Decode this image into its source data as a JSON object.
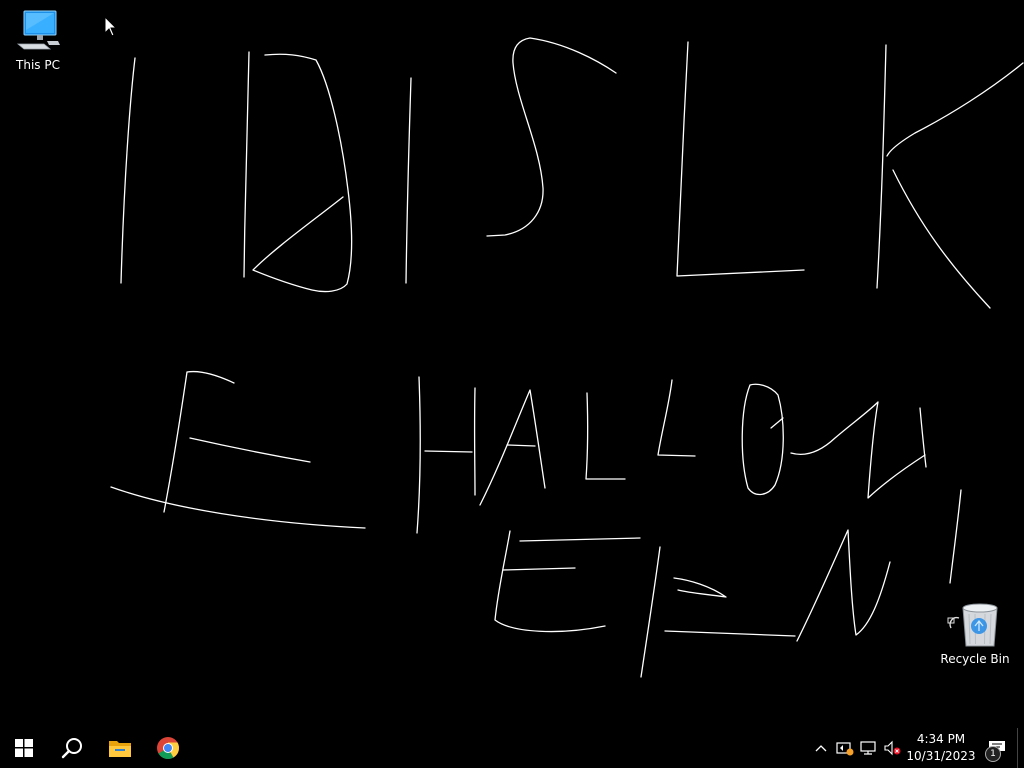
{
  "desktop": {
    "icons": [
      {
        "label": "This PC",
        "icon": "this-pc-icon"
      },
      {
        "label": "Recycle Bin",
        "icon": "recycle-bin-icon"
      }
    ]
  },
  "taskbar": {
    "pinned": [
      {
        "icon": "windows-start-icon"
      },
      {
        "icon": "search-icon"
      },
      {
        "icon": "file-explorer-icon"
      },
      {
        "icon": "chrome-icon"
      }
    ],
    "tray": {
      "icons": [
        "chevron-up-icon",
        "security-warning-icon",
        "network-icon",
        "volume-muted-icon"
      ],
      "time": "4:34 PM",
      "date": "10/31/2023",
      "notification_count": "1"
    }
  },
  "colors": {
    "background": "#000000",
    "stroke": "#ffffff",
    "taskbar": "#000000"
  }
}
